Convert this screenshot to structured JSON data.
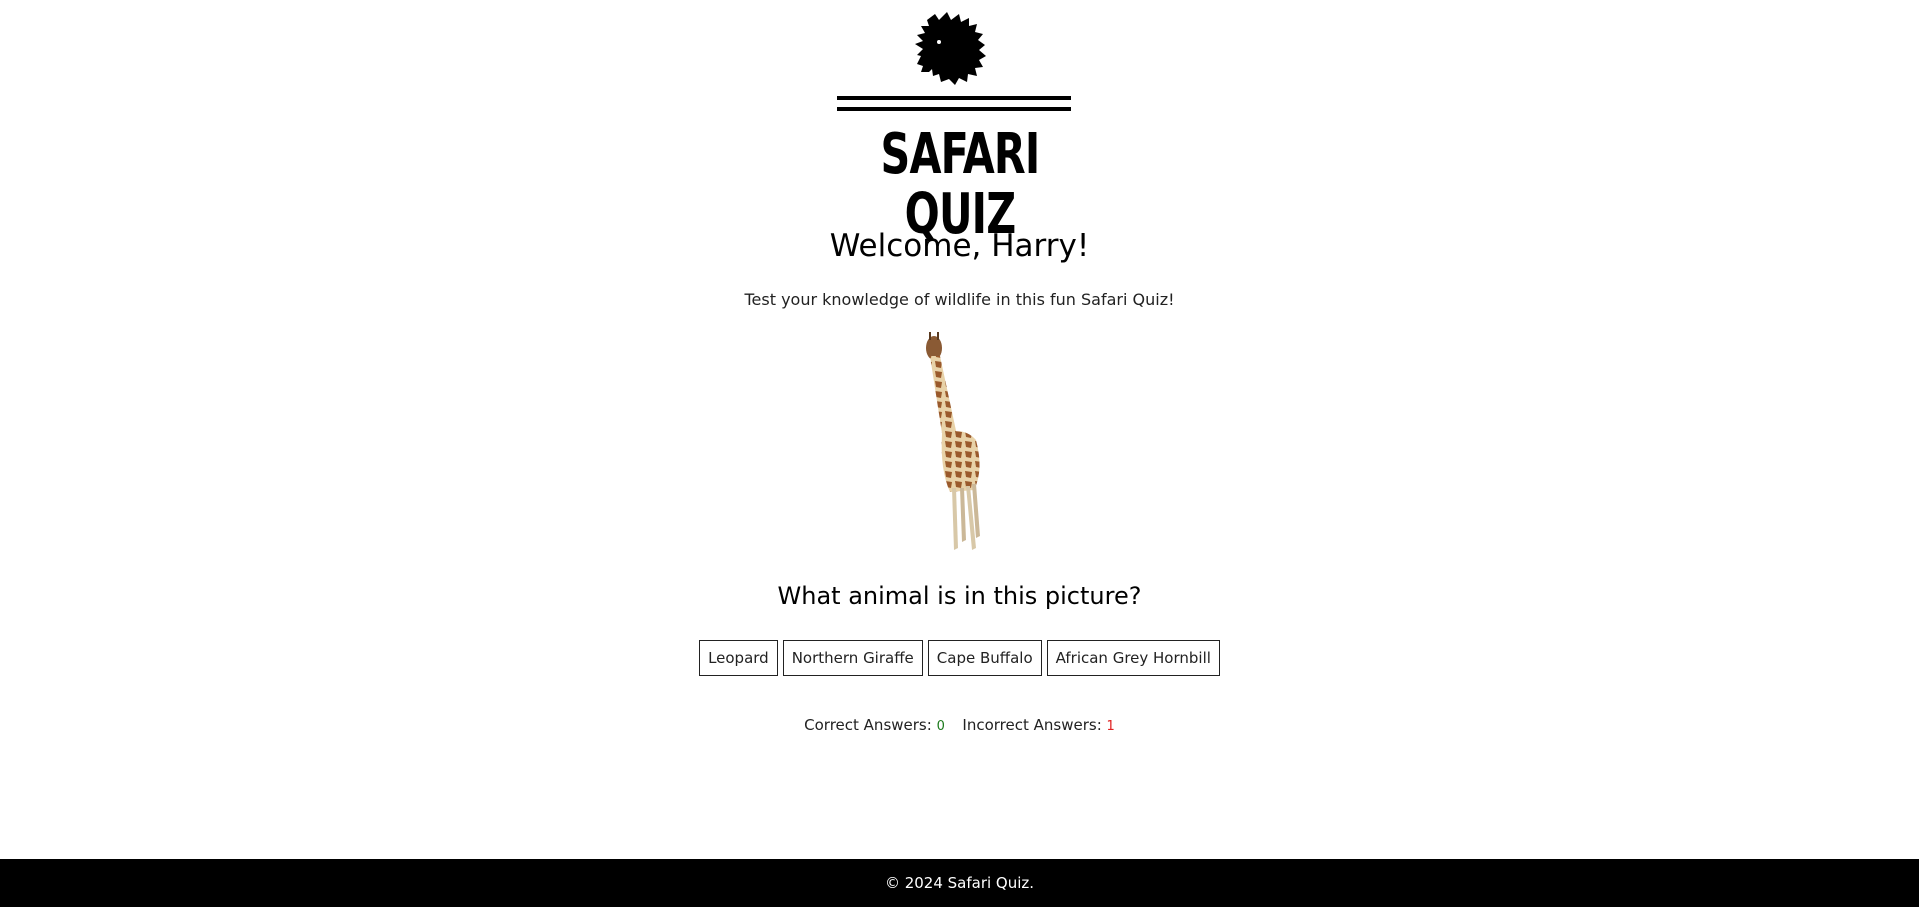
{
  "logo": {
    "text": "SAFARI QUIZ",
    "icon": "lion-head-icon"
  },
  "welcome": {
    "title": "Welcome, Harry!",
    "tagline": "Test your knowledge of wildlife in this fun Safari Quiz!"
  },
  "quiz": {
    "image_subject": "giraffe-icon",
    "question": "What animal is in this picture?",
    "answers": [
      {
        "label": "Leopard"
      },
      {
        "label": "Northern Giraffe"
      },
      {
        "label": "Cape Buffalo"
      },
      {
        "label": "African Grey Hornbill"
      }
    ]
  },
  "score": {
    "correct_label": "Correct Answers:",
    "correct_value": "0",
    "incorrect_label": "Incorrect Answers:",
    "incorrect_value": "1"
  },
  "footer": {
    "text": "© 2024 Safari Quiz."
  },
  "colors": {
    "correct": "#1c7a1c",
    "incorrect": "#e02020",
    "footer_bg": "#000000"
  }
}
